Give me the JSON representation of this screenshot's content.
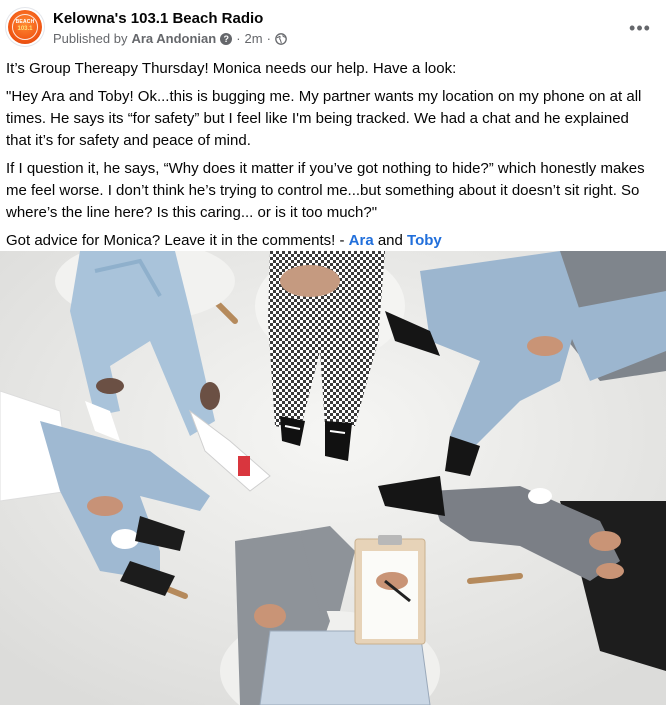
{
  "header": {
    "page_name": "Kelowna's 103.1 Beach Radio",
    "published_by_prefix": "Published by",
    "author": "Ara Andonian",
    "help_glyph": "?",
    "separator": "·",
    "time": "2m",
    "more_glyph": "•••",
    "avatar": {
      "line1": "BEACH",
      "line2": "103.1"
    }
  },
  "post": {
    "para1": "It’s Group Thereapy Thursday! Monica needs our help. Have a look:",
    "para2": "\"Hey Ara and Toby! Ok...this is bugging me. My partner wants my location on my phone on at all times. He says its “for safety” but I feel like I'm being tracked. We had a chat and he explained that it’s for safety and peace of mind.",
    "para3": "If I question it, he says, “Why does it matter if you’ve got nothing to hide?” which honestly makes me feel worse. I don’t think he’s trying to control me...but something about it doesn’t sit right. So where’s the line here? Is this caring... or is it too much?\"",
    "para4_prefix": "Got advice for Monica? Leave it in the comments! - ",
    "mention1": "Ara",
    "para4_and": " and ",
    "mention2": "Toby"
  },
  "colors": {
    "link": "#216fdb",
    "secondary_text": "#65676b",
    "brand_orange": "#f25a16"
  }
}
